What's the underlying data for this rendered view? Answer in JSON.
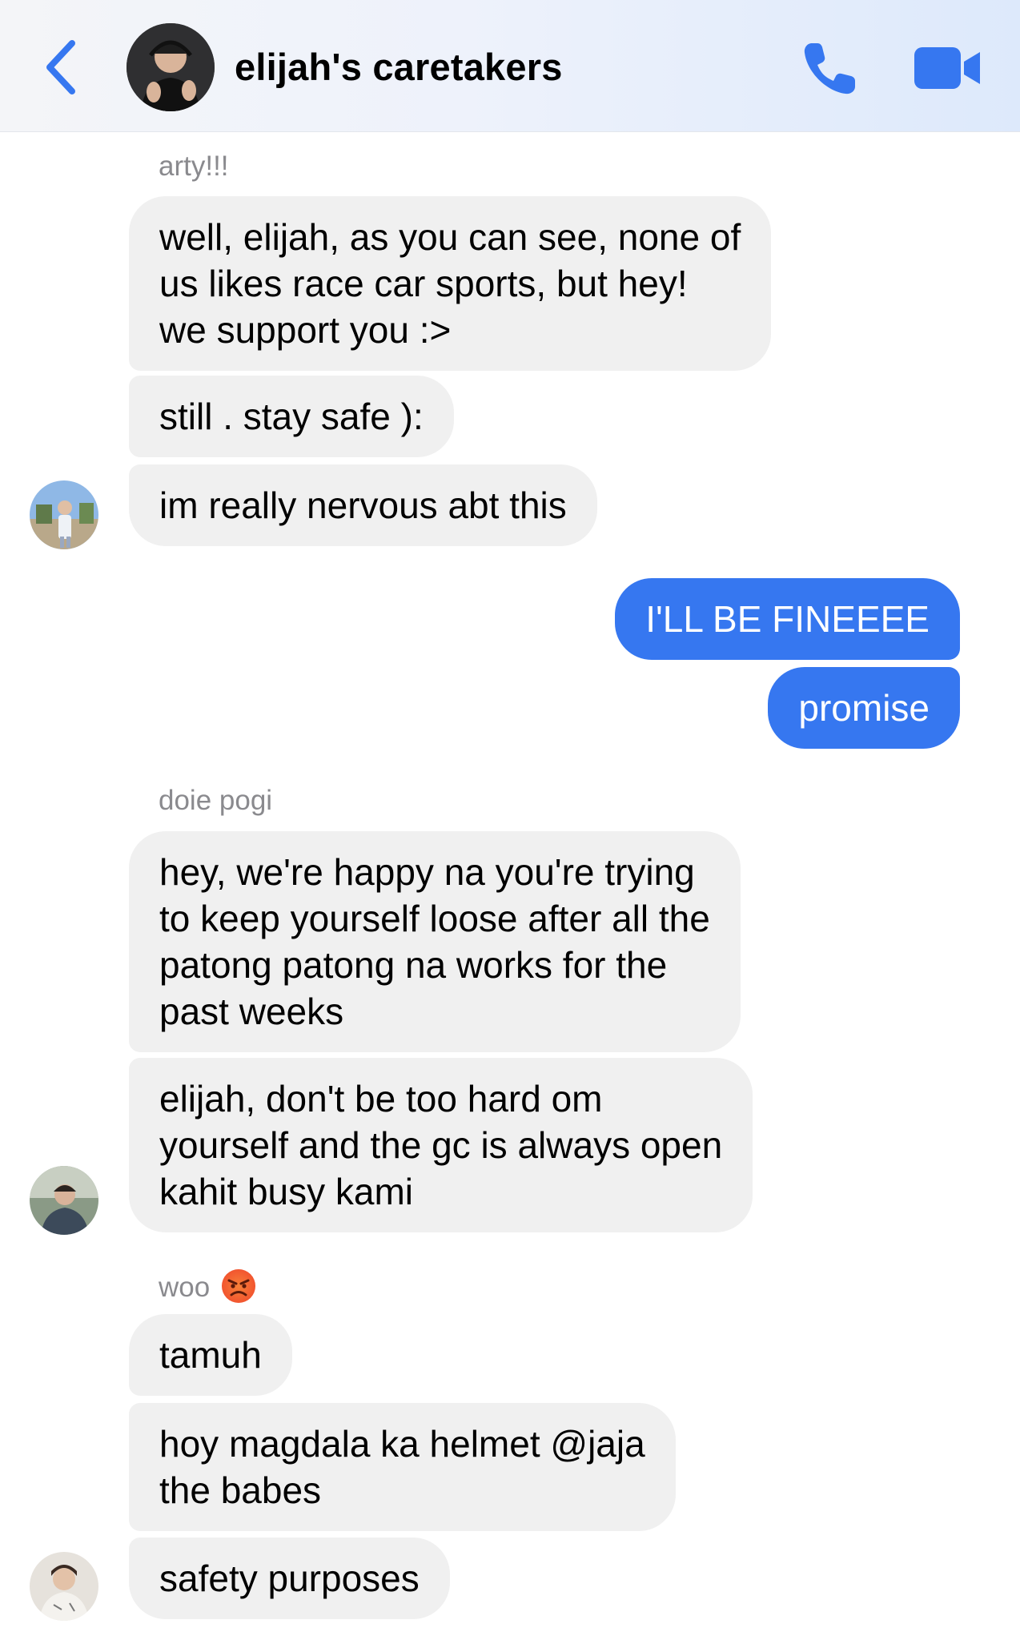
{
  "header": {
    "back_icon": "chevron-left-icon",
    "title": "elijah's caretakers",
    "call_icon": "phone-icon",
    "video_icon": "video-camera-icon",
    "accent": "#3677f0"
  },
  "groups": [
    {
      "sender": "arty!!!",
      "messages": [
        {
          "lines": [
            "well, elijah, as you can see, none of",
            "us likes race car sports, but hey!",
            "we support you :>"
          ]
        },
        {
          "lines": [
            "still . stay safe ):"
          ]
        },
        {
          "lines": [
            "im really nervous abt this"
          ]
        }
      ]
    },
    {
      "sender": "me",
      "messages": [
        {
          "lines": [
            "I'LL BE FINEEEE"
          ]
        },
        {
          "lines": [
            "promise"
          ]
        }
      ]
    },
    {
      "sender": "doie pogi",
      "messages": [
        {
          "lines": [
            "hey, we're happy na you're trying",
            "to keep yourself loose after all the",
            "patong patong na works for the",
            "past weeks"
          ]
        },
        {
          "lines": [
            "elijah, don't be too hard om",
            "yourself and the gc is always open",
            "kahit busy kami"
          ]
        }
      ]
    },
    {
      "sender": "woo",
      "sender_emoji": "angry-face-icon",
      "messages": [
        {
          "lines": [
            "tamuh"
          ]
        },
        {
          "lines": [
            "hoy magdala ka helmet @jaja",
            "the babes"
          ]
        },
        {
          "lines": [
            "safety purposes"
          ]
        }
      ]
    }
  ],
  "colors": {
    "incoming_bubble": "#f0f0f0",
    "outgoing_bubble": "#3677f0",
    "sender_name": "#8a8a8e"
  }
}
